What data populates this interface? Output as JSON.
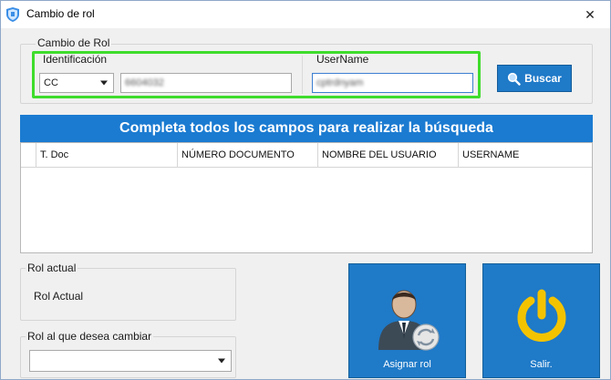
{
  "window": {
    "title": "Cambio de rol",
    "close_glyph": "✕"
  },
  "search_group": {
    "legend": "Cambio de Rol",
    "identificacion_label": "Identificación",
    "doc_type_value": "CC",
    "doc_number_value": "6604032",
    "username_label": "UserName",
    "username_value": "cptrdnyam",
    "buscar_label": "Buscar"
  },
  "banner": {
    "text": "Completa todos los campos para realizar la búsqueda"
  },
  "table": {
    "columns": [
      "T. Doc",
      "NÚMERO DOCUMENTO",
      "NOMBRE DEL USUARIO",
      "USERNAME"
    ],
    "rows": []
  },
  "rol_actual": {
    "legend": "Rol actual",
    "value": "Rol Actual"
  },
  "rol_cambiar": {
    "legend": "Rol al que desea cambiar",
    "selected": ""
  },
  "actions": {
    "asignar_label": "Asignar rol",
    "salir_label": "Salir."
  },
  "colors": {
    "accent_blue": "#1f7ac8",
    "highlight_green": "#3fdc2c",
    "power_yellow": "#f3c300"
  }
}
